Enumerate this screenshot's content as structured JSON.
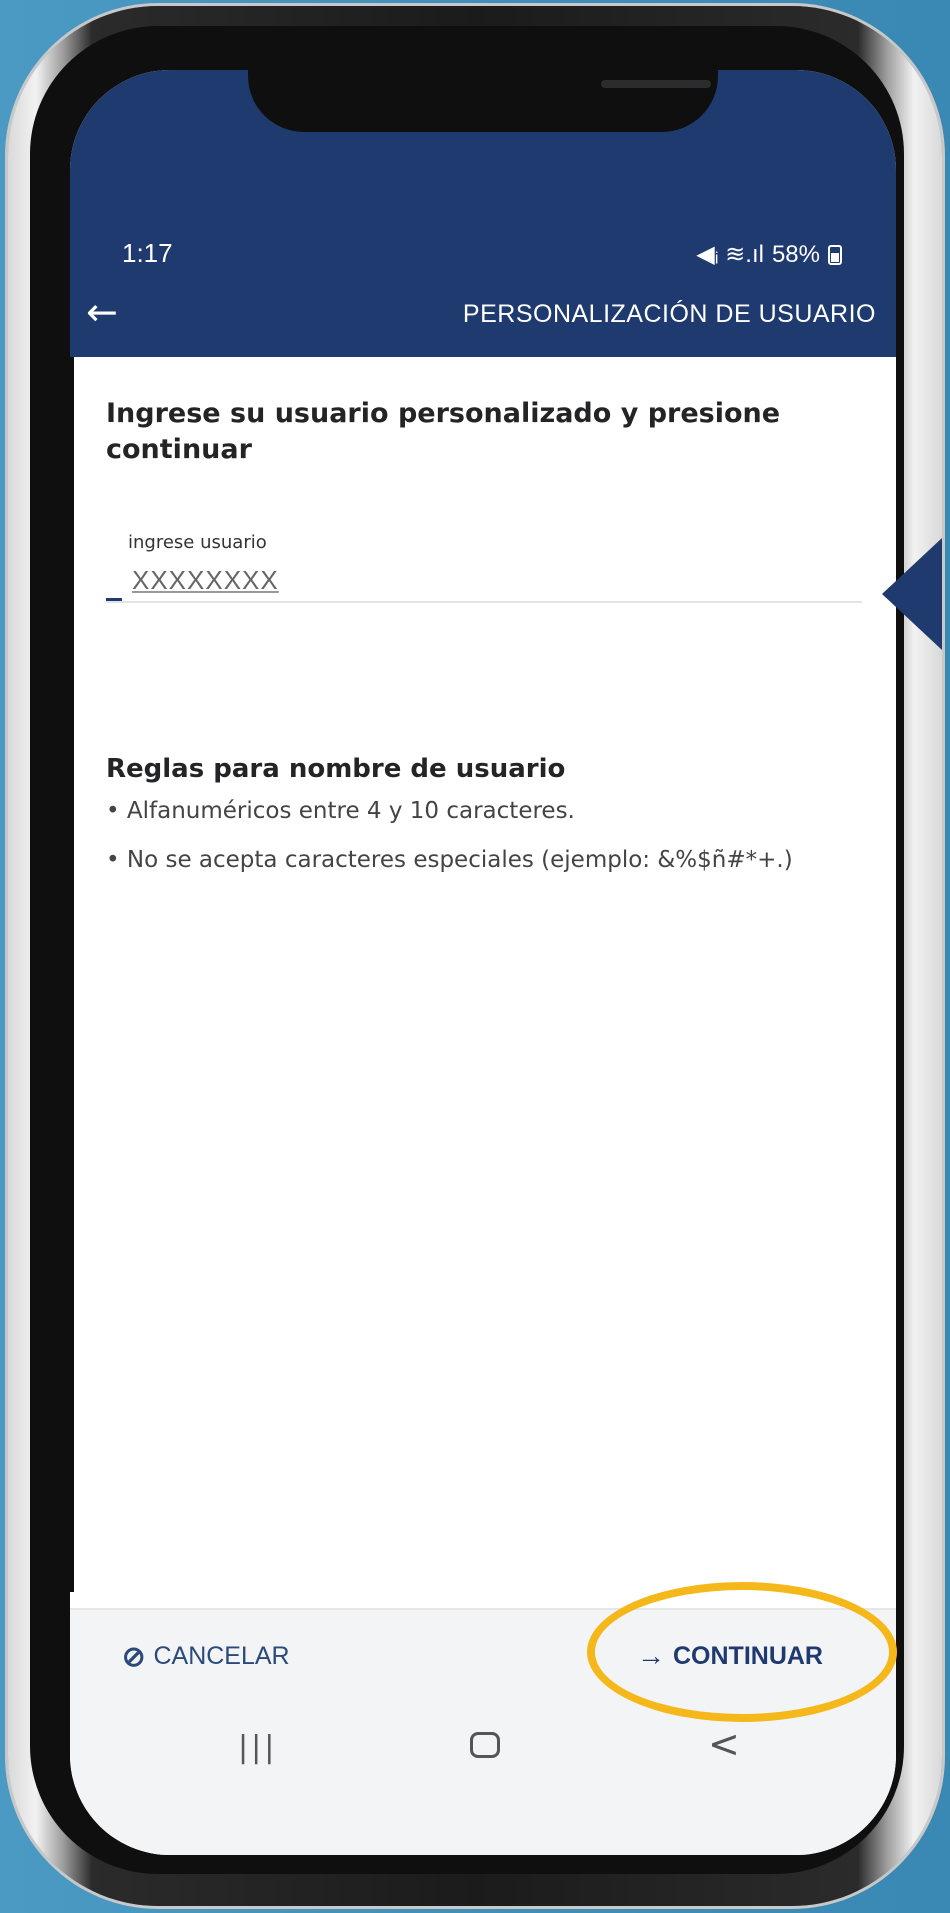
{
  "status_bar": {
    "time": "1:17",
    "signal_icons": "🔇 ◜ .ıl",
    "battery": "58%"
  },
  "header": {
    "title": "PERSONALIZACIÓN DE USUARIO",
    "back_icon": "arrow-left-icon"
  },
  "form": {
    "instructions": "Ingrese su usuario personalizado y presione continuar",
    "input_label": "ingrese usuario",
    "input_value": "XXXXXXXX"
  },
  "rules": {
    "title": "Reglas para nombre de usuario",
    "items": [
      "• Alfanuméricos entre 4 y 10 caracteres.",
      "• No se acepta caracteres especiales (ejemplo: &%$ñ#*+.)"
    ]
  },
  "footer": {
    "cancel_label": "CANCELAR",
    "continue_label": "CONTINUAR"
  },
  "colors": {
    "brand": "#1f3a6e",
    "highlight": "#f5b81b",
    "background": "#4a9ac4"
  }
}
